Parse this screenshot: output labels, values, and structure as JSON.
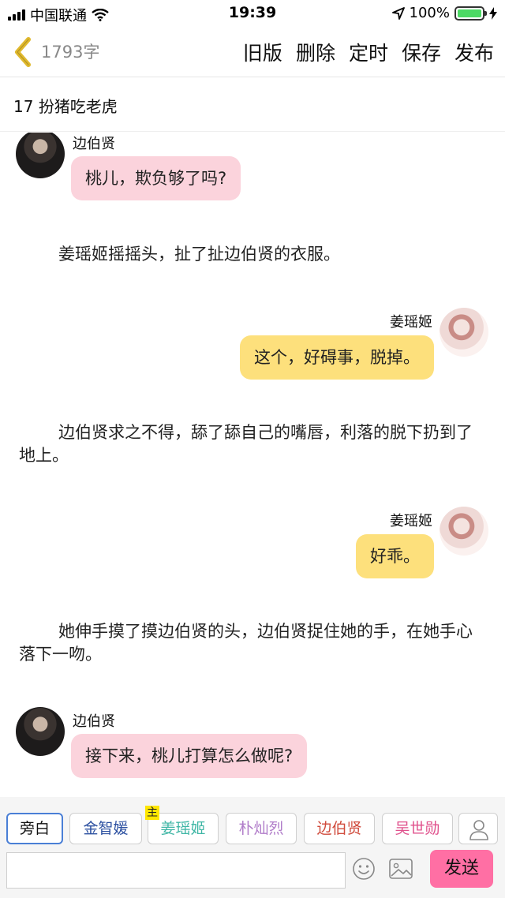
{
  "status_bar": {
    "carrier": "中国联通",
    "time": "19:39",
    "battery": "100%",
    "battery_level": 1.0
  },
  "nav": {
    "word_count": "1793字",
    "actions": [
      "旧版",
      "删除",
      "定时",
      "保存",
      "发布"
    ]
  },
  "chapter": {
    "title": "17 扮猪吃老虎"
  },
  "messages": [
    {
      "type": "dialog",
      "speaker": "边伯贤",
      "side": "left",
      "text": "桃儿，欺负够了吗?",
      "avatar_icon": "avatar-dark-hair-male",
      "bubble_color": "#fbd3dc"
    },
    {
      "type": "narration",
      "text": "姜瑶姬摇摇头，扯了扯边伯贤的衣服。"
    },
    {
      "type": "dialog",
      "speaker": "姜瑶姬",
      "side": "right",
      "text": "这个，好碍事，脱掉。",
      "avatar_icon": "avatar-sketch-female",
      "bubble_color": "#fde07c"
    },
    {
      "type": "narration",
      "text": "边伯贤求之不得，舔了舔自己的嘴唇，利落的脱下扔到了地上。"
    },
    {
      "type": "dialog",
      "speaker": "姜瑶姬",
      "side": "right",
      "text": "好乖。",
      "avatar_icon": "avatar-sketch-female",
      "bubble_color": "#fde07c"
    },
    {
      "type": "narration",
      "text": "她伸手摸了摸边伯贤的头，边伯贤捉住她的手，在她手心落下一吻。"
    },
    {
      "type": "dialog",
      "speaker": "边伯贤",
      "side": "left",
      "text": "接下来，桃儿打算怎么做呢?",
      "avatar_icon": "avatar-dark-hair-male",
      "bubble_color": "#fbd3dc"
    }
  ],
  "roles": [
    {
      "label": "旁白",
      "color": "#222222",
      "active": true
    },
    {
      "label": "金智媛",
      "color": "#2b4fa0",
      "active": false
    },
    {
      "label": "姜瑶姬",
      "color": "#3fb6a5",
      "active": false,
      "tag": "主"
    },
    {
      "label": "朴灿烈",
      "color": "#b07cc9",
      "active": false
    },
    {
      "label": "边伯贤",
      "color": "#d04b3c",
      "active": false
    },
    {
      "label": "吴世勋",
      "color": "#e0508c",
      "active": false
    }
  ],
  "input": {
    "value": "",
    "placeholder": "",
    "send_label": "发送"
  },
  "colors": {
    "accent_back": "#e0b92e",
    "send_button": "#ff6fa4",
    "left_bubble": "#fbd3dc",
    "right_bubble": "#fde07c",
    "active_tab_border": "#4a7fd6"
  }
}
